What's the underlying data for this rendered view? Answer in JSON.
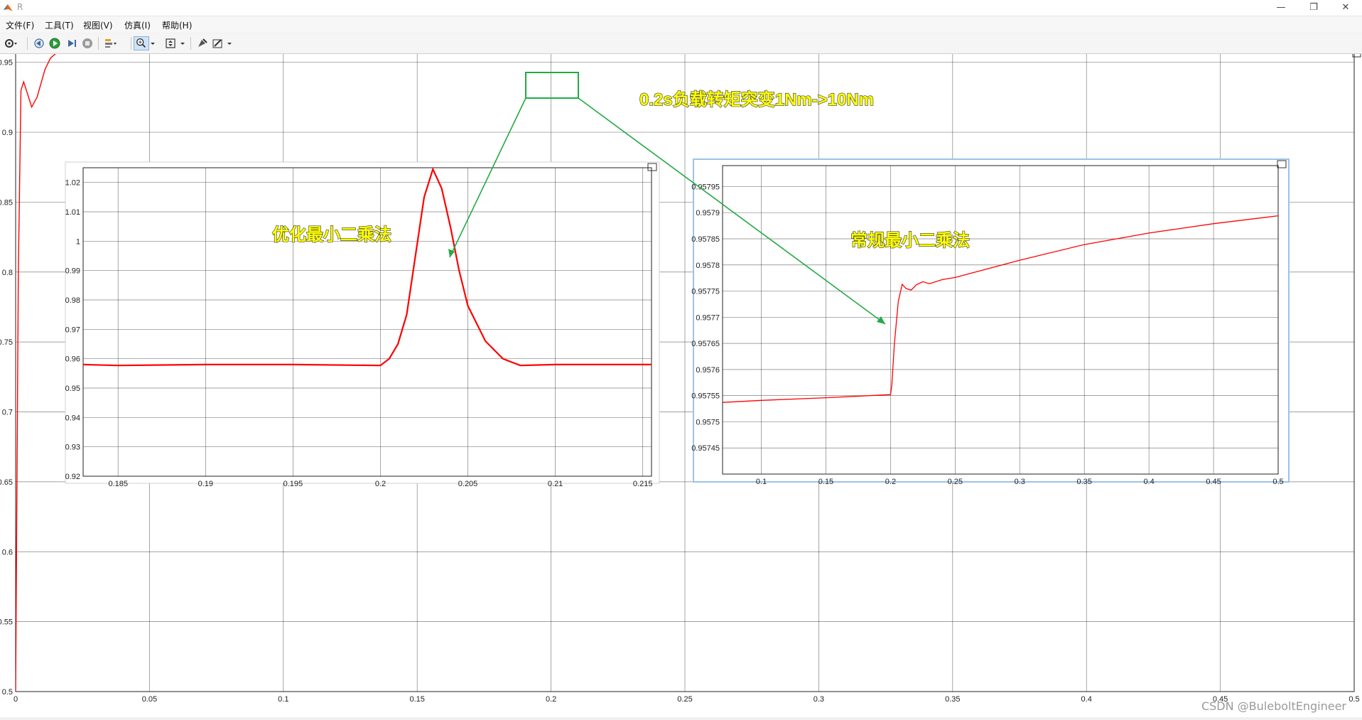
{
  "window": {
    "title": "R",
    "minimize_glyph": "—",
    "restore_glyph": "❐",
    "close_glyph": "✕"
  },
  "menu": [
    "文件(F)",
    "工具(T)",
    "视图(V)",
    "仿真(I)",
    "帮助(H)"
  ],
  "toolbar": {
    "icons": [
      "settings-icon",
      "step-back-icon",
      "run-icon",
      "step-forward-icon",
      "stop-icon",
      "highlight-icon",
      "zoom-in-icon",
      "fit-icon",
      "style-icon",
      "edit-icon"
    ]
  },
  "annotations": {
    "main": "0.2s负载转矩突变1Nm->10Nm",
    "left_label": "优化最小二乘法",
    "right_label": "常规最小二乘法"
  },
  "colors": {
    "signal": "#ff0000",
    "callout": "#22aa44",
    "label_fill": "#ffff00",
    "label_stroke": "#333333"
  },
  "watermark": "CSDN @BuleboltEngineer",
  "chart_data": [
    {
      "type": "line",
      "xlim": [
        0,
        0.5
      ],
      "ylim": [
        0.5,
        0.96
      ],
      "x_ticks": [
        0,
        0.05,
        0.1,
        0.15,
        0.2,
        0.25,
        0.3,
        0.35,
        0.4,
        0.45,
        0.5
      ],
      "x_tick_labels": [
        "0",
        "0.05",
        "0.1",
        "0.15",
        "0.2",
        "0.25",
        "0.3",
        "0.35",
        "0.4",
        "0.45",
        "0.5"
      ],
      "y_ticks": [
        0.5,
        0.55,
        0.6,
        0.65,
        0.7,
        0.75,
        0.8,
        0.85,
        0.9,
        0.95
      ],
      "y_tick_labels": [
        "0.5",
        "0.55",
        "0.6",
        "0.65",
        "0.7",
        "0.75",
        "0.8",
        "0.85",
        "0.9",
        "0.95"
      ],
      "grid": true,
      "series": [
        {
          "x": [
            0,
            0.001,
            0.002,
            0.003,
            0.004,
            0.006,
            0.008,
            0.011,
            0.013,
            0.016,
            0.5
          ],
          "y": [
            0.5,
            0.8,
            0.93,
            0.936,
            0.93,
            0.918,
            0.925,
            0.945,
            0.953,
            0.958,
            0.958
          ]
        }
      ]
    },
    {
      "type": "line",
      "xlim": [
        0.183,
        0.2155
      ],
      "ylim": [
        0.92,
        1.025
      ],
      "x_ticks": [
        0.185,
        0.19,
        0.195,
        0.2,
        0.205,
        0.21,
        0.215
      ],
      "x_tick_labels": [
        "0.185",
        "0.19",
        "0.195",
        "0.2",
        "0.205",
        "0.21",
        "0.215"
      ],
      "y_ticks": [
        0.92,
        0.93,
        0.94,
        0.95,
        0.96,
        0.97,
        0.98,
        0.99,
        1,
        1.01,
        1.02
      ],
      "y_tick_labels": [
        "0.92",
        "0.93",
        "0.94",
        "0.95",
        "0.96",
        "0.97",
        "0.98",
        "0.99",
        "1",
        "1.01",
        "1.02"
      ],
      "grid": true,
      "series": [
        {
          "x": [
            0.183,
            0.185,
            0.19,
            0.195,
            0.2,
            0.2005,
            0.201,
            0.2015,
            0.202,
            0.2025,
            0.203,
            0.2035,
            0.204,
            0.2045,
            0.205,
            0.206,
            0.207,
            0.208,
            0.21,
            0.2155
          ],
          "y": [
            0.958,
            0.9577,
            0.958,
            0.958,
            0.9577,
            0.96,
            0.965,
            0.975,
            0.995,
            1.015,
            1.0245,
            1.018,
            1.005,
            0.99,
            0.978,
            0.966,
            0.96,
            0.9577,
            0.958,
            0.958
          ]
        }
      ]
    },
    {
      "type": "line",
      "xlim": [
        0.07,
        0.5
      ],
      "ylim": [
        0.9574,
        0.95799
      ],
      "x_ticks": [
        0.1,
        0.15,
        0.2,
        0.25,
        0.3,
        0.35,
        0.4,
        0.45,
        0.5
      ],
      "x_tick_labels": [
        "0.1",
        "0.15",
        "0.2",
        "0.25",
        "0.3",
        "0.35",
        "0.4",
        "0.45",
        "0.5"
      ],
      "y_ticks": [
        0.95745,
        0.9575,
        0.95755,
        0.9576,
        0.95765,
        0.9577,
        0.95775,
        0.9578,
        0.95785,
        0.9579,
        0.95795
      ],
      "y_tick_labels": [
        "0.95745",
        "0.9575",
        "0.95755",
        "0.9576",
        "0.95765",
        "0.9577",
        "0.95775",
        "0.9578",
        "0.95785",
        "0.9579",
        "0.95795"
      ],
      "grid": true,
      "series": [
        {
          "x": [
            0.07,
            0.1,
            0.15,
            0.2,
            0.201,
            0.203,
            0.206,
            0.209,
            0.212,
            0.216,
            0.22,
            0.225,
            0.23,
            0.24,
            0.25,
            0.3,
            0.35,
            0.4,
            0.45,
            0.5
          ],
          "y": [
            0.957537,
            0.957541,
            0.957546,
            0.957552,
            0.95757,
            0.95765,
            0.95773,
            0.957763,
            0.957755,
            0.957752,
            0.957762,
            0.957768,
            0.957764,
            0.957772,
            0.957776,
            0.957809,
            0.957839,
            0.957861,
            0.957879,
            0.957894
          ]
        }
      ]
    }
  ]
}
